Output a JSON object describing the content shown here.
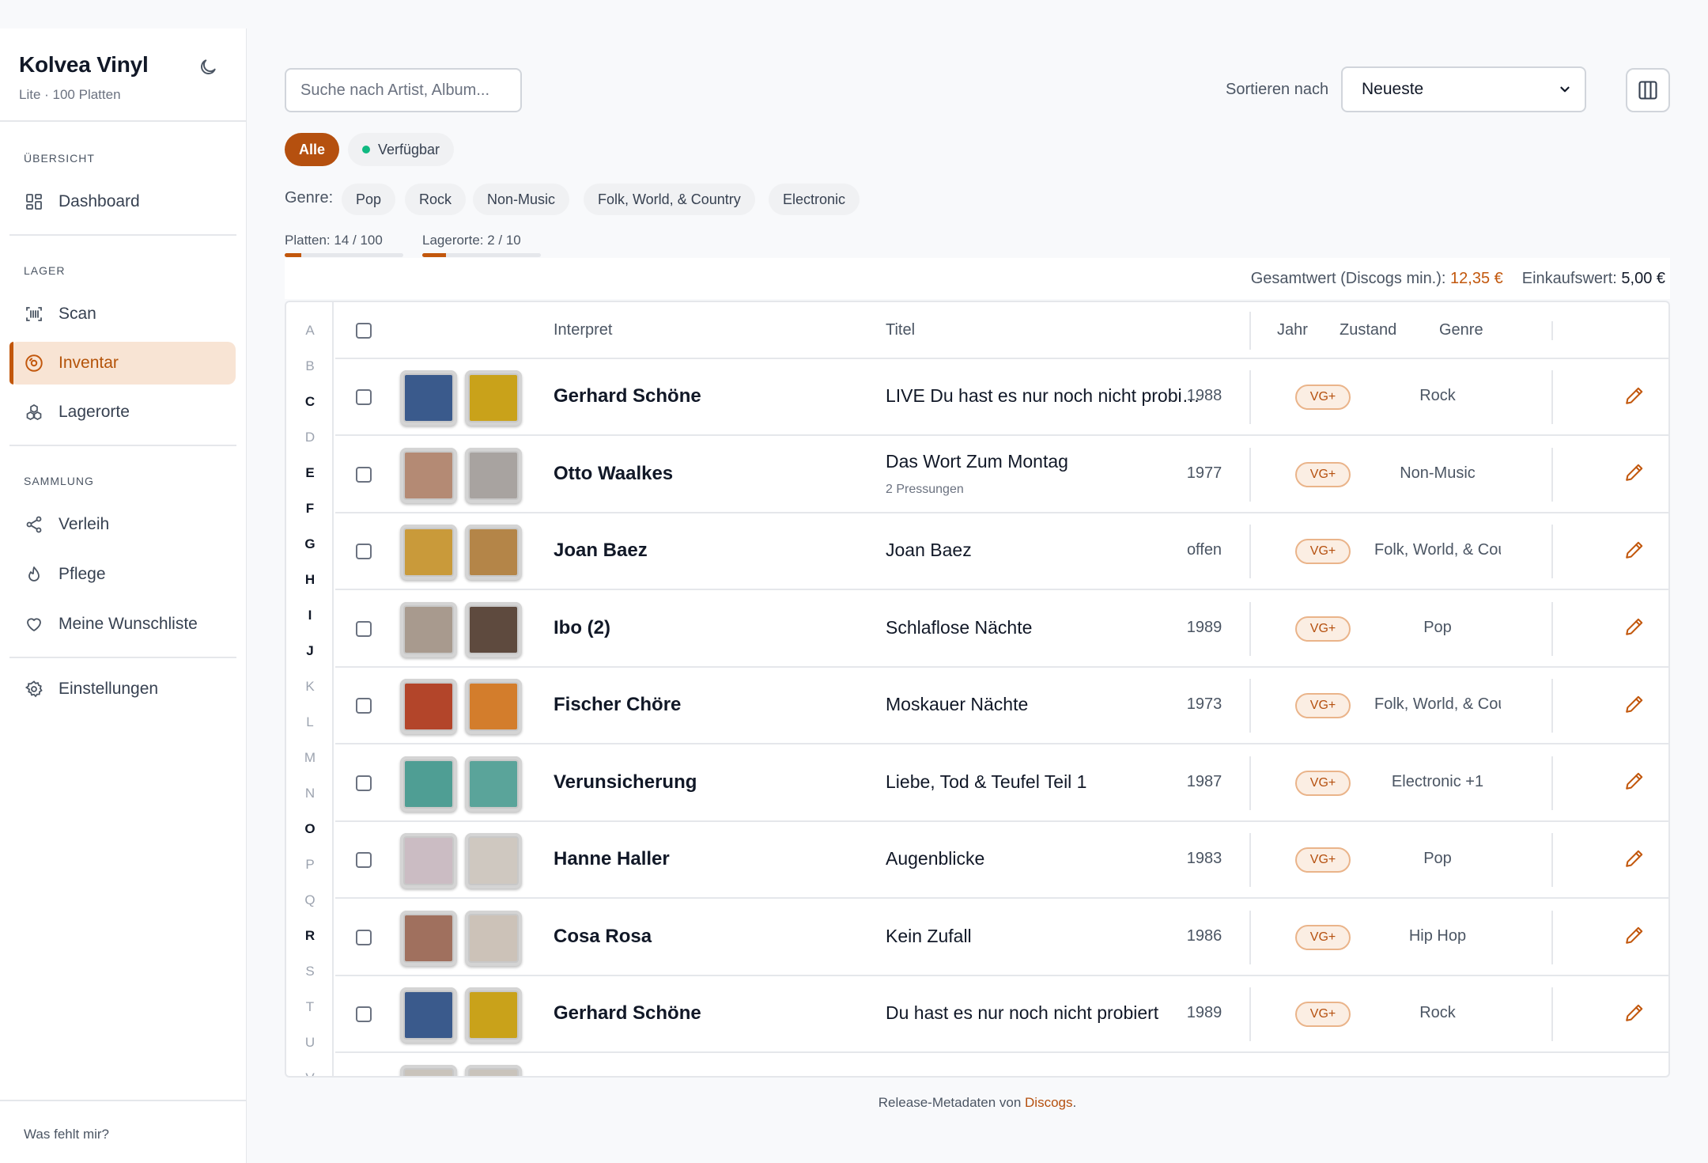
{
  "app": {
    "title": "Kolvea Vinyl",
    "subtitle": "Lite · 100 Platten",
    "footer_link": "Was fehlt mir?"
  },
  "sidebar": {
    "sections": [
      {
        "label": "ÜBERSICHT",
        "items": [
          {
            "label": "Dashboard",
            "icon": "dashboard-icon"
          }
        ]
      },
      {
        "label": "LAGER",
        "items": [
          {
            "label": "Scan",
            "icon": "scan-icon"
          },
          {
            "label": "Inventar",
            "icon": "record-icon",
            "active": true
          },
          {
            "label": "Lagerorte",
            "icon": "boxes-icon"
          }
        ]
      },
      {
        "label": "SAMMLUNG",
        "items": [
          {
            "label": "Verleih",
            "icon": "share-icon"
          },
          {
            "label": "Pflege",
            "icon": "drop-icon"
          },
          {
            "label": "Meine Wunschliste",
            "icon": "heart-icon"
          }
        ]
      },
      {
        "label": "",
        "items": [
          {
            "label": "Einstellungen",
            "icon": "gear-icon"
          }
        ]
      }
    ]
  },
  "search": {
    "placeholder": "Suche nach Artist, Album..."
  },
  "sort": {
    "label": "Sortieren nach",
    "value": "Neueste"
  },
  "filters": {
    "all": "Alle",
    "available": "Verfügbar"
  },
  "genres": {
    "label": "Genre:",
    "items": [
      "Pop",
      "Rock",
      "Non-Music",
      "Folk, World, & Country",
      "Electronic"
    ]
  },
  "quotas": {
    "records": {
      "label": "Platten: 14 / 100",
      "fraction": 0.14
    },
    "locations": {
      "label": "Lagerorte: 2 / 10",
      "fraction": 0.2
    }
  },
  "totals": {
    "value_label": "Gesamtwert (Discogs min.):",
    "value": "12,35 €",
    "purchase_label": "Einkaufswert:",
    "purchase": "5,00 €"
  },
  "alphabet": [
    "A",
    "B",
    "C",
    "D",
    "E",
    "F",
    "G",
    "H",
    "I",
    "J",
    "K",
    "L",
    "M",
    "N",
    "O",
    "P",
    "Q",
    "R",
    "S",
    "T",
    "U",
    "V"
  ],
  "alphabet_active": [
    "C",
    "E",
    "F",
    "G",
    "H",
    "I",
    "J",
    "O",
    "R"
  ],
  "table": {
    "headers": {
      "artist": "Interpret",
      "title": "Titel",
      "year": "Jahr",
      "condition": "Zustand",
      "genre": "Genre"
    },
    "rows": [
      {
        "artist": "Gerhard Schöne",
        "title": "LIVE Du hast es nur noch nicht probiert",
        "subtitle": "",
        "year": "1988",
        "condition": "VG+",
        "genre": "Rock",
        "colors": [
          "#3a5a8c",
          "#c9a21a"
        ]
      },
      {
        "artist": "Otto Waalkes",
        "title": "Das Wort Zum Montag",
        "subtitle": "2 Pressungen",
        "year": "1977",
        "condition": "VG+",
        "genre": "Non-Music",
        "colors": [
          "#b48a74",
          "#a8a3a0"
        ]
      },
      {
        "artist": "Joan Baez",
        "title": "Joan Baez",
        "subtitle": "",
        "year": "offen",
        "condition": "VG+",
        "genre": "Folk, World, & Country",
        "colors": [
          "#c99a3a",
          "#b48548"
        ]
      },
      {
        "artist": "Ibo (2)",
        "title": "Schlaflose Nächte",
        "subtitle": "",
        "year": "1989",
        "condition": "VG+",
        "genre": "Pop",
        "colors": [
          "#a89a8e",
          "#5e4a3e"
        ]
      },
      {
        "artist": "Fischer Chöre",
        "title": "Moskauer Nächte",
        "subtitle": "",
        "year": "1973",
        "condition": "VG+",
        "genre": "Folk, World, & Country",
        "colors": [
          "#b3452a",
          "#d37d2c"
        ]
      },
      {
        "artist": "Verunsicherung",
        "title": "Liebe, Tod & Teufel Teil 1",
        "subtitle": "",
        "year": "1987",
        "condition": "VG+",
        "genre": "Electronic +1",
        "colors": [
          "#4f9e94",
          "#5aa49a"
        ]
      },
      {
        "artist": "Hanne Haller",
        "title": "Augenblicke",
        "subtitle": "",
        "year": "1983",
        "condition": "VG+",
        "genre": "Pop",
        "colors": [
          "#cbbcc3",
          "#cfc8c0"
        ]
      },
      {
        "artist": "Cosa Rosa",
        "title": "Kein Zufall",
        "subtitle": "",
        "year": "1986",
        "condition": "VG+",
        "genre": "Hip Hop",
        "colors": [
          "#a0705e",
          "#ccc2b8"
        ]
      },
      {
        "artist": "Gerhard Schöne",
        "title": "Du hast es nur noch nicht probiert",
        "subtitle": "",
        "year": "1989",
        "condition": "VG+",
        "genre": "Rock",
        "colors": [
          "#3a5a8c",
          "#c9a21a"
        ]
      }
    ]
  },
  "credit": {
    "prefix": "Release-Metadaten von ",
    "link": "Discogs",
    "suffix": "."
  },
  "colors": {
    "accent": "#b5500f",
    "active_bg": "#f8e4d4",
    "available_dot": "#10b981"
  }
}
